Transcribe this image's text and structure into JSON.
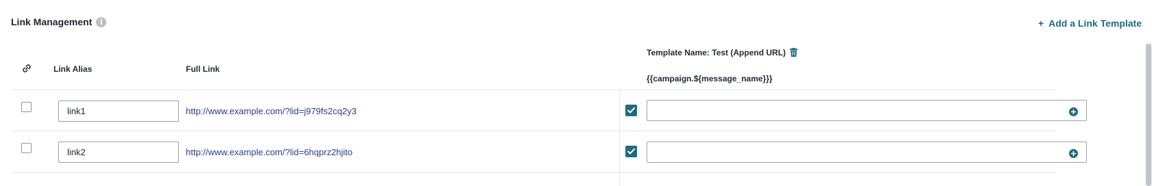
{
  "header": {
    "title": "Link Management",
    "info_icon": "info-icon",
    "add_template_label": "Add a Link Template",
    "add_template_icon": "plus-icon"
  },
  "table": {
    "columns": {
      "link_icon": "link-icon",
      "alias": "Link Alias",
      "full_link": "Full Link"
    },
    "template": {
      "name_label": "Template Name: Test (Append URL)",
      "delete_icon": "trash-icon",
      "param": "{{campaign.${message_name}}}"
    },
    "rows": [
      {
        "selected": false,
        "alias": "link1",
        "full_link": "http://www.example.com/?lid=j979fs2cq2y3",
        "template_enabled": true,
        "template_value": ""
      },
      {
        "selected": false,
        "alias": "link2",
        "full_link": "http://www.example.com/?lid=6hqprz2hjito",
        "template_enabled": true,
        "template_value": ""
      }
    ]
  },
  "colors": {
    "accent": "#1f6b80",
    "link": "#2c3a92",
    "border": "#e3e6ea"
  }
}
